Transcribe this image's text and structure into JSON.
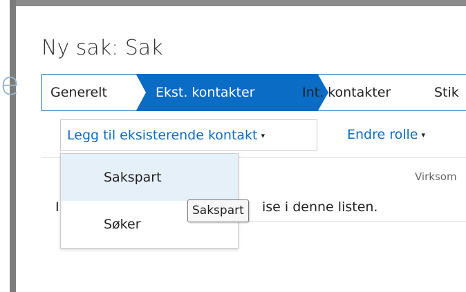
{
  "background": {
    "partial_letter": "e"
  },
  "page": {
    "title": "Ny sak: Sak"
  },
  "tabs": [
    {
      "label": "Generelt",
      "active": false
    },
    {
      "label": "Ekst. kontakter",
      "active": true
    },
    {
      "label": "Int. kontakter",
      "active": false
    },
    {
      "label": "Stik",
      "active": false
    }
  ],
  "toolbar": {
    "add_existing_label": "Legg til eksisterende kontakt",
    "change_role_label": "Endre rolle",
    "caret": "▾"
  },
  "list": {
    "column_partial": ":",
    "column_virksomhet": "Virksom",
    "empty_prefix": "I",
    "empty_message_visible": "ise i denne listen."
  },
  "dropdown": {
    "items": [
      {
        "label": "Sakspart",
        "hovered": true
      },
      {
        "label": "Søker",
        "hovered": false
      }
    ]
  },
  "tooltip": {
    "text": "Sakspart"
  },
  "colors": {
    "accent": "#0a6cc4",
    "hover_bg": "#e6f0f9",
    "frame": "#7c7c7c"
  }
}
